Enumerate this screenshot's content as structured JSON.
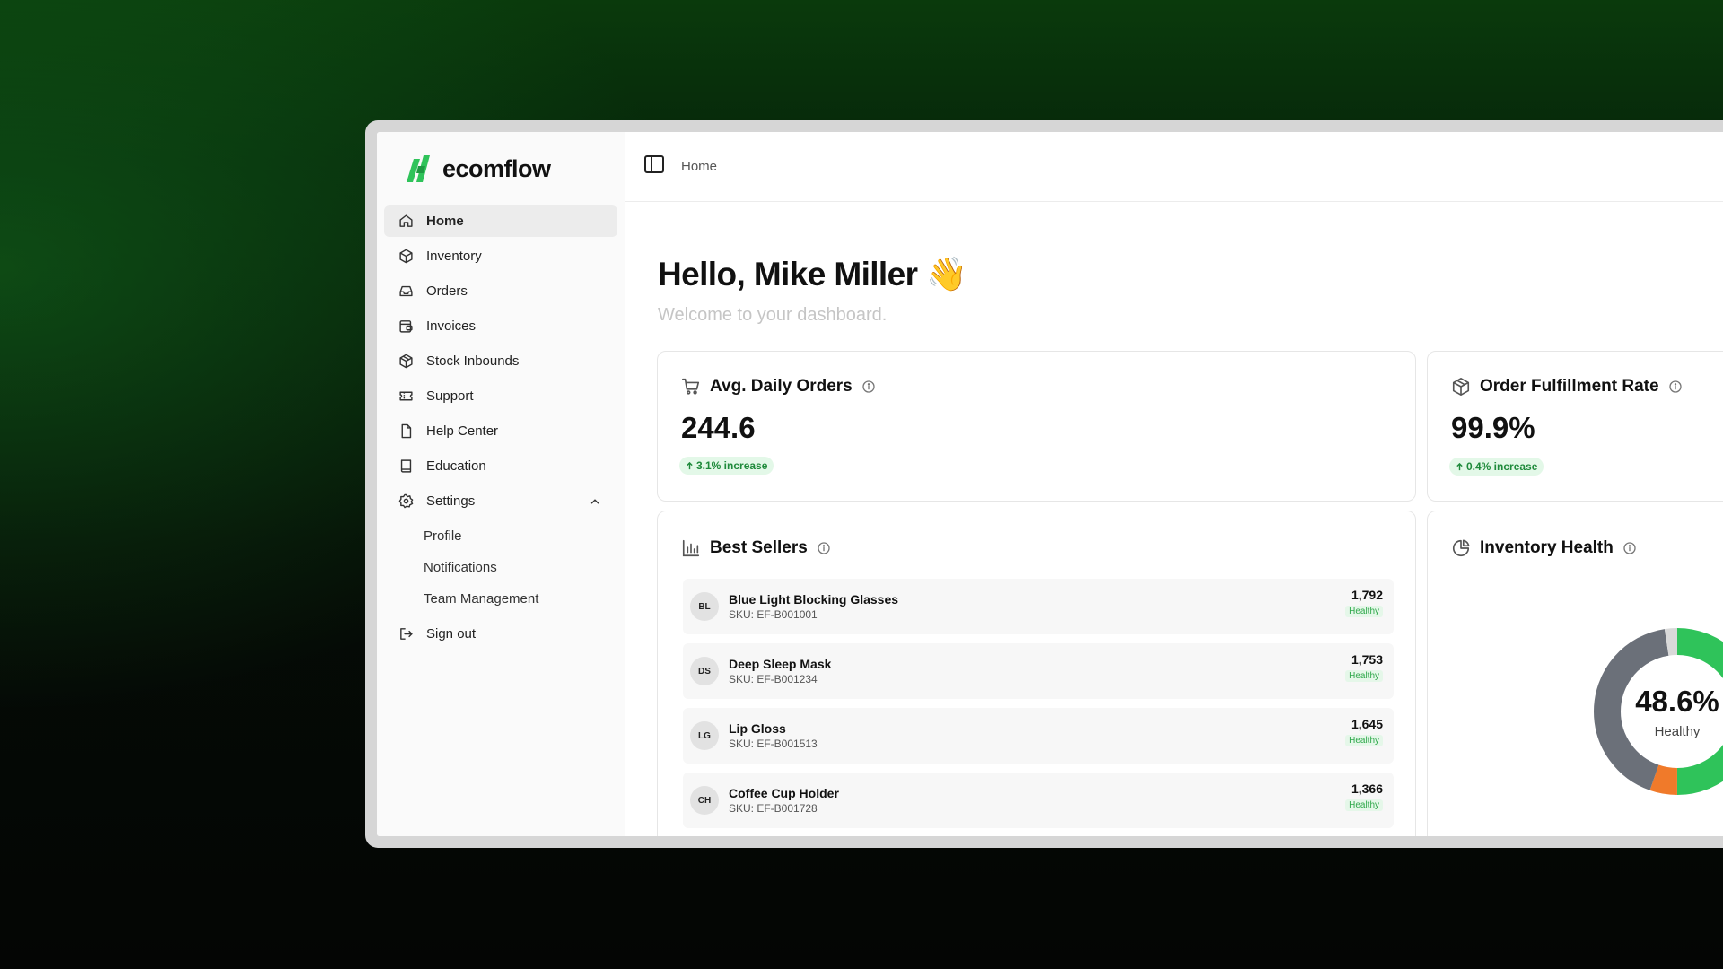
{
  "brand": {
    "name": "ecomflow",
    "color": "#2fc35a"
  },
  "sidebar": {
    "items": [
      {
        "label": "Home",
        "icon": "home-icon"
      },
      {
        "label": "Inventory",
        "icon": "box-icon"
      },
      {
        "label": "Orders",
        "icon": "inbox-icon"
      },
      {
        "label": "Invoices",
        "icon": "invoice-icon"
      },
      {
        "label": "Stock Inbounds",
        "icon": "boxes-icon"
      },
      {
        "label": "Support",
        "icon": "ticket-icon"
      },
      {
        "label": "Help Center",
        "icon": "file-icon"
      },
      {
        "label": "Education",
        "icon": "book-icon"
      },
      {
        "label": "Settings",
        "icon": "gear-icon"
      }
    ],
    "settings_sub": [
      "Profile",
      "Notifications",
      "Team Management"
    ],
    "signout": "Sign out"
  },
  "topbar": {
    "breadcrumb": "Home"
  },
  "greeting": {
    "title": "Hello, Mike Miller 👋",
    "subtitle": "Welcome to your dashboard."
  },
  "kpis": {
    "avg_orders": {
      "title": "Avg. Daily Orders",
      "value": "244.6",
      "change": "3.1% increase"
    },
    "fulfillment": {
      "title": "Order Fulfillment Rate",
      "value": "99.9%",
      "change": "0.4% increase"
    }
  },
  "best_sellers": {
    "title": "Best Sellers",
    "rows": [
      {
        "initials": "BL",
        "name": "Blue Light Blocking Glasses",
        "sku": "SKU: EF-B001001",
        "qty": "1,792",
        "status": "Healthy"
      },
      {
        "initials": "DS",
        "name": "Deep Sleep Mask",
        "sku": "SKU: EF-B001234",
        "qty": "1,753",
        "status": "Healthy"
      },
      {
        "initials": "LG",
        "name": "Lip Gloss",
        "sku": "SKU: EF-B001513",
        "qty": "1,645",
        "status": "Healthy"
      },
      {
        "initials": "CH",
        "name": "Coffee Cup Holder",
        "sku": "SKU: EF-B001728",
        "qty": "1,366",
        "status": "Healthy"
      }
    ]
  },
  "inventory_health": {
    "title": "Inventory Health",
    "center_value": "48.6%",
    "center_label": "Healthy",
    "colors": {
      "healthy": "#2fc35a",
      "warning": "#f07a2a",
      "other": "#6b7079",
      "neutral": "#d9d9d9"
    }
  }
}
